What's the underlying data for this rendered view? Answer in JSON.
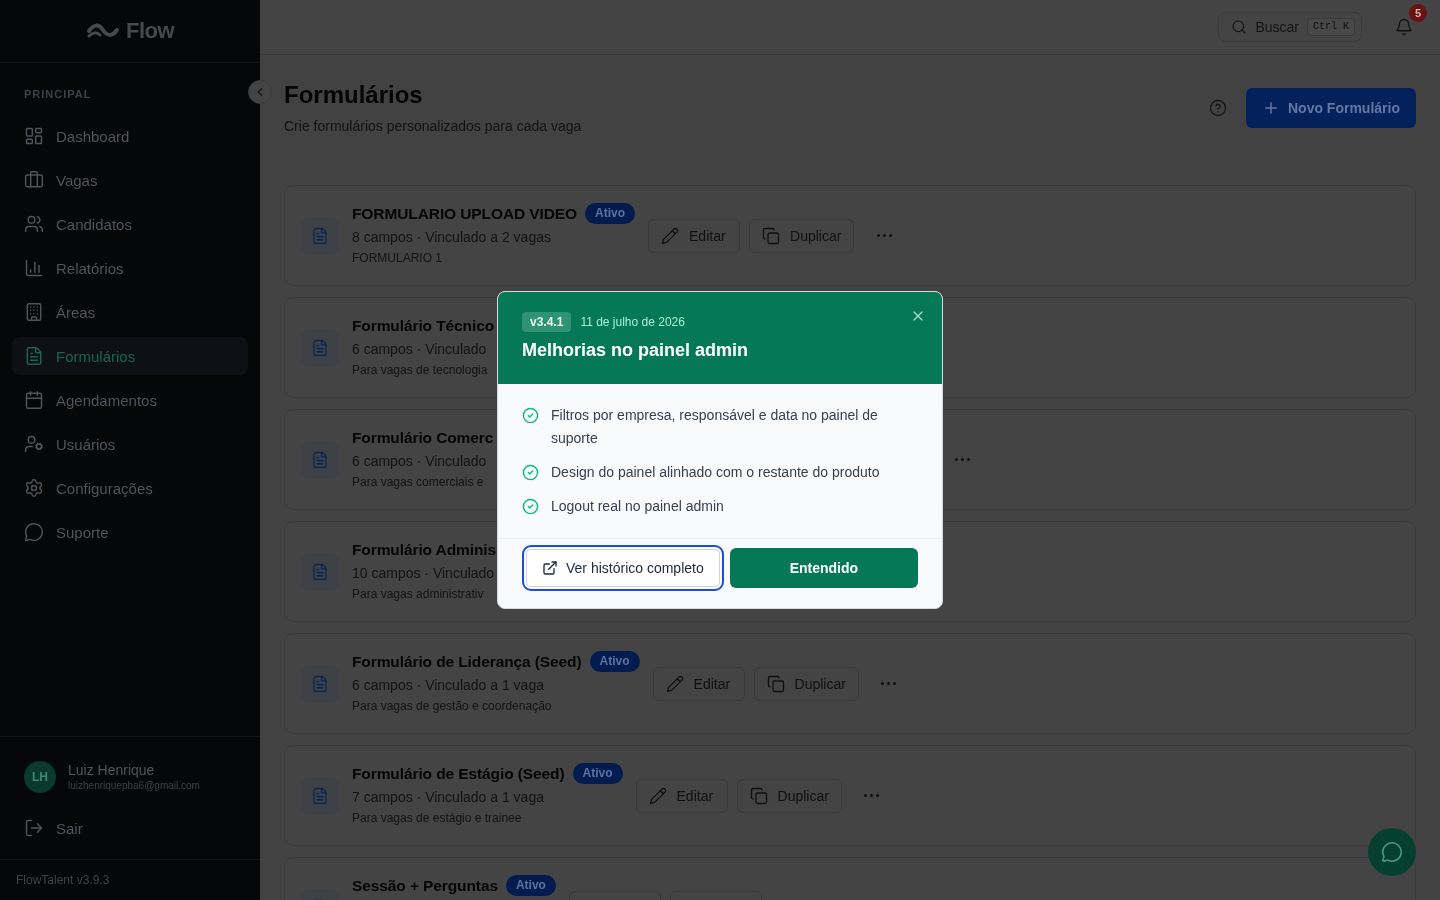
{
  "sidebar": {
    "logo": "Flow",
    "section_label": "PRINCIPAL",
    "items": [
      {
        "label": "Dashboard",
        "selected": false
      },
      {
        "label": "Vagas",
        "selected": false
      },
      {
        "label": "Candidatos",
        "selected": false
      },
      {
        "label": "Relatórios",
        "selected": false
      },
      {
        "label": "Áreas",
        "selected": false
      },
      {
        "label": "Formulários",
        "selected": true
      },
      {
        "label": "Agendamentos",
        "selected": false
      },
      {
        "label": "Usuários",
        "selected": false
      },
      {
        "label": "Configurações",
        "selected": false
      },
      {
        "label": "Suporte",
        "selected": false
      }
    ],
    "user": {
      "initials": "LH",
      "name": "Luiz Henrique",
      "email": "luizhenriquepba6@gmail.com"
    },
    "logout": "Sair",
    "version": "FlowTalent v3.9.3"
  },
  "topbar": {
    "search": {
      "label": "Buscar",
      "shortcut": "Ctrl K"
    },
    "notifications": {
      "count": "5"
    }
  },
  "page_header": {
    "title": "Formulários",
    "subtitle": "Crie formulários personalizados para cada vaga",
    "new_button": "Novo Formulário"
  },
  "forms": [
    {
      "title": "FORMULARIO UPLOAD VIDEO",
      "status": "Ativo",
      "meta": "8 campos · Vinculado a 2 vagas",
      "description": "FORMULARIO 1",
      "actions": [
        {
          "kind": "edit",
          "label": "Editar"
        },
        {
          "kind": "duplicate",
          "label": "Duplicar"
        },
        {
          "kind": "more"
        }
      ]
    },
    {
      "title": "Formulário Técnico",
      "meta": "6 campos · Vinculado",
      "description": "Para vagas de tecnologia"
    },
    {
      "title": "Formulário Comerc",
      "meta": "6 campos · Vinculado",
      "description": "Para vagas comerciais e",
      "actions": [
        {
          "kind": "more"
        }
      ]
    },
    {
      "title": "Formulário Adminis",
      "meta": "10 campos · Vinculado",
      "description": "Para vagas administrativ"
    },
    {
      "title": "Formulário de Liderança (Seed)",
      "status": "Ativo",
      "meta": "6 campos · Vinculado a 1 vaga",
      "description": "Para vagas de gestão e coordenação",
      "actions": [
        {
          "kind": "edit",
          "label": "Editar"
        },
        {
          "kind": "duplicate",
          "label": "Duplicar"
        },
        {
          "kind": "more"
        }
      ]
    },
    {
      "title": "Formulário de Estágio (Seed)",
      "status": "Ativo",
      "meta": "7 campos · Vinculado a 1 vaga",
      "description": "Para vagas de estágio e trainee",
      "actions": [
        {
          "kind": "edit",
          "label": "Editar"
        },
        {
          "kind": "duplicate",
          "label": "Duplicar"
        },
        {
          "kind": "more"
        }
      ]
    },
    {
      "title": "Sessão + Perguntas",
      "status": "Ativo",
      "actions": [
        {
          "kind": "edit"
        },
        {
          "kind": "duplicate"
        }
      ]
    }
  ],
  "modal": {
    "version": "v3.4.1",
    "date": "11 de julho de 2026",
    "title": "Melhorias no painel admin",
    "items": [
      "Filtros por empresa, responsável e data no painel de suporte",
      "Design do painel alinhado com o restante do produto",
      "Logout real no painel admin"
    ],
    "secondary_button": {
      "label": "Ver histórico completo",
      "focused": true
    },
    "primary_button": "Entendido"
  }
}
